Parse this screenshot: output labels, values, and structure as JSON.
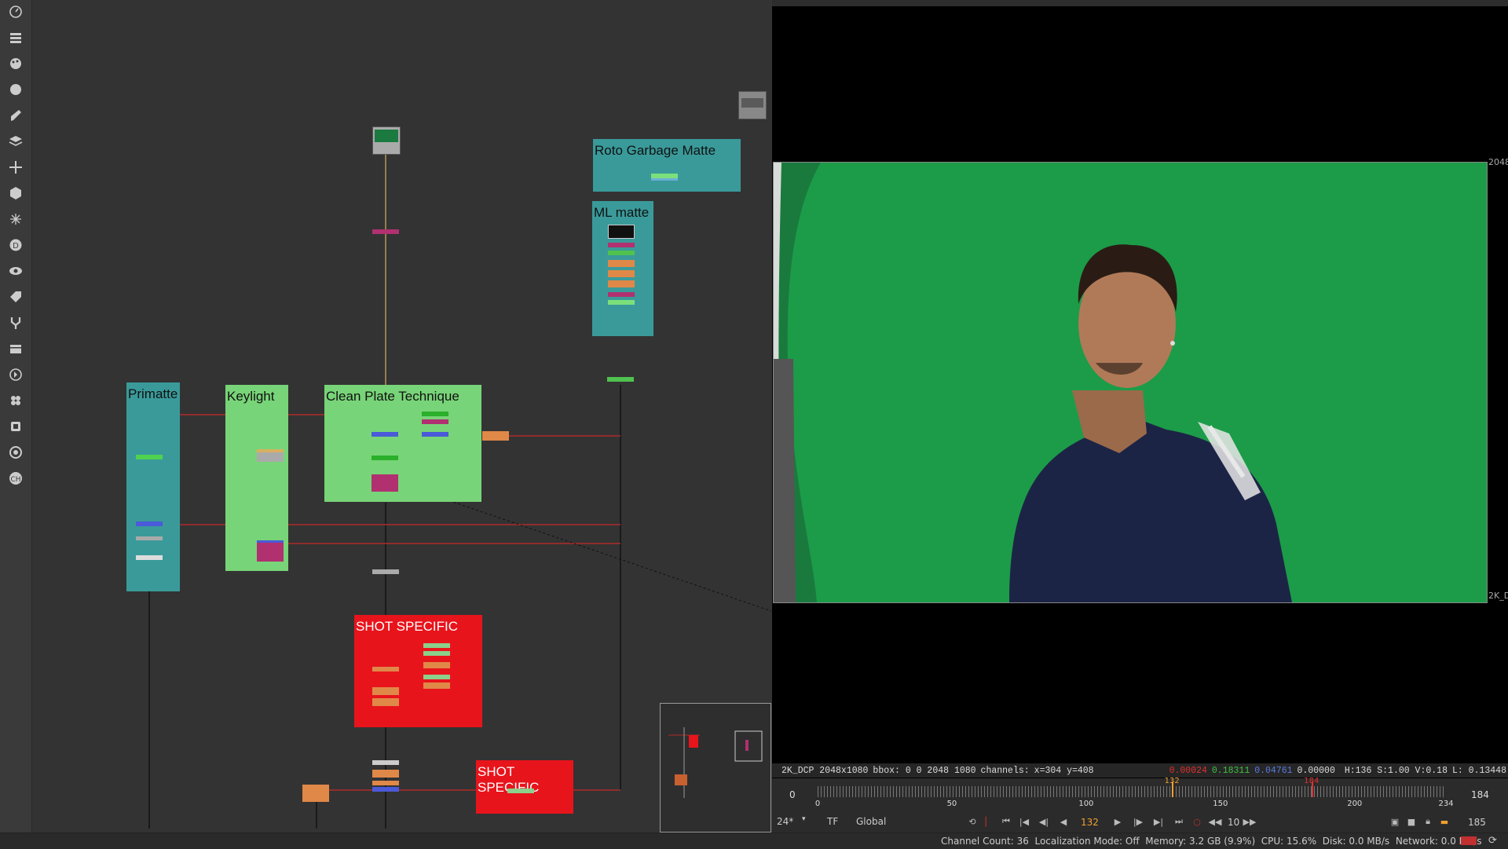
{
  "toolbar": {
    "icons": [
      "timer-icon",
      "menu-icon",
      "palette-icon",
      "circle-icon",
      "draw-icon",
      "layers-icon",
      "transform-icon",
      "3d-box-icon",
      "particles-icon",
      "d-icon",
      "eye-icon",
      "tag-icon",
      "gizmo-icon",
      "stack-icon",
      "furnace-icon",
      "ocio-icon",
      "cube-icon",
      "settings-icon",
      "hub-icon"
    ]
  },
  "node_graph": {
    "backdrops": {
      "roto_garbage": "Roto Garbage Matte",
      "ml_matte": "ML matte",
      "primatte": "Primatte",
      "keylight": "Keylight",
      "clean_plate": "Clean Plate Technique",
      "shot_specific_1": "SHOT SPECIFIC",
      "shot_specific_2": "SHOT SPECIFIC"
    },
    "colors": {
      "teal": "#3a9a9a",
      "light_green": "#78d478",
      "red": "#e8141c",
      "wire_red": "#b02a2a",
      "wire_yellow": "#d8b060"
    }
  },
  "viewer": {
    "format_label_right_top": "2048",
    "format_label_right_bottom": "2K_D",
    "info_bar": {
      "format": "2K_DCP 2048x1080",
      "bbox": "bbox: 0 0 2048 1080",
      "channels": "channels:",
      "coords": "x=304 y=408",
      "r": "0.00024",
      "g": "0.18311",
      "b": "0.04761",
      "a": "0.00000",
      "hsv": "H:136 S:1.00 V:0.18",
      "luma": "L: 0.13448"
    },
    "timeline": {
      "in_frame": "0",
      "out_frame": "184",
      "ticks": [
        "0",
        "50",
        "100",
        "150",
        "200",
        "234"
      ],
      "current_frame_marker": "132",
      "out_marker": "184",
      "current_frame_fraction": 0.564,
      "out_marker_fraction": 0.786
    },
    "controls": {
      "fps": "24*",
      "tf": "TF",
      "scope": "Global",
      "frame": "132",
      "increment": "10",
      "end_frame": "185"
    }
  },
  "status_bar": {
    "text": "Channel Count: 36  Localization Mode: Off  Memory: 3.2 GB (9.9%)  CPU: 15.6%  Disk: 0.0 MB/s  Network: 0.0 MB/s"
  }
}
